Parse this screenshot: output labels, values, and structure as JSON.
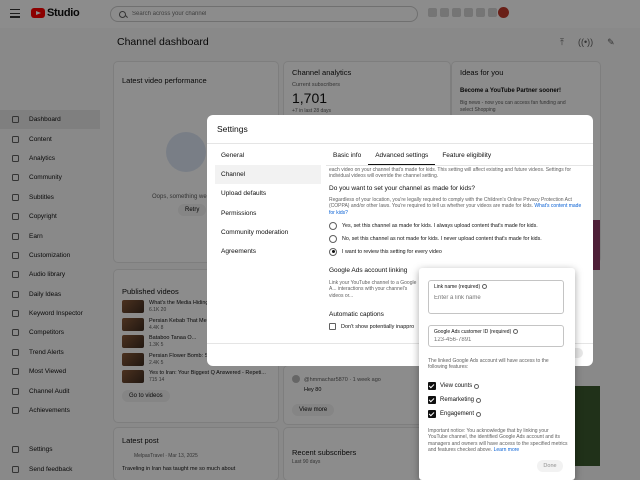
{
  "app": {
    "logo_text": "Studio"
  },
  "search": {
    "placeholder": "Search across your channel"
  },
  "page": {
    "title": "Channel dashboard"
  },
  "sidebar": {
    "items": [
      {
        "label": "Dashboard",
        "icon": "dashboard-icon",
        "active": true
      },
      {
        "label": "Content",
        "icon": "content-icon"
      },
      {
        "label": "Analytics",
        "icon": "analytics-icon"
      },
      {
        "label": "Community",
        "icon": "community-icon"
      },
      {
        "label": "Subtitles",
        "icon": "subtitles-icon"
      },
      {
        "label": "Copyright",
        "icon": "copyright-icon"
      },
      {
        "label": "Earn",
        "icon": "earn-icon"
      },
      {
        "label": "Customization",
        "icon": "customization-icon"
      },
      {
        "label": "Audio library",
        "icon": "audio-library-icon"
      },
      {
        "label": "Daily Ideas",
        "icon": "daily-ideas-icon"
      },
      {
        "label": "Keyword Inspector",
        "icon": "keyword-icon"
      },
      {
        "label": "Competitors",
        "icon": "competitors-icon"
      },
      {
        "label": "Trend Alerts",
        "icon": "trend-icon"
      },
      {
        "label": "Most Viewed",
        "icon": "most-viewed-icon"
      },
      {
        "label": "Channel Audit",
        "icon": "audit-icon"
      },
      {
        "label": "Achievements",
        "icon": "achievements-icon"
      }
    ],
    "bottom": [
      {
        "label": "Settings",
        "icon": "gear-icon"
      },
      {
        "label": "Send feedback",
        "icon": "feedback-icon"
      }
    ]
  },
  "cards": {
    "latest_video": {
      "title": "Latest video performance",
      "error": "Oops, something we",
      "retry": "Retry"
    },
    "analytics": {
      "title": "Channel analytics",
      "subs_label": "Current subscribers",
      "subs_value": "1,701",
      "subs_delta": "+7 in last 28 days"
    },
    "ideas": {
      "title": "Ideas for you",
      "headline": "Become a YouTube Partner sooner!",
      "body": "Big news - now you can access fan funding and select Shopping"
    },
    "published": {
      "title": "Published videos",
      "videos": [
        {
          "title": "What's the Media Hiding",
          "stats": "6.1K  20"
        },
        {
          "title": "Persian Kebab That Melt",
          "stats": "4.4K  8"
        },
        {
          "title": "Bataboo Tanaa O...",
          "stats": "1.3K  5"
        },
        {
          "title": "Persian Flower Bomb: Saff",
          "stats": "2.4K  5"
        },
        {
          "title": "Yes to Iran: Your Biggest Q Answered - Repeti...",
          "stats": "715  14"
        }
      ],
      "go_button": "Go to videos"
    },
    "comment": {
      "author": "@hmmachar5870 · 1 week ago",
      "reply": "Hey 80",
      "view_more": "View more"
    },
    "latest_post": {
      "title": "Latest post",
      "author": "MelpasTravel · Mar 13, 2025",
      "body": "Traveling in Iran has taught me so much about"
    },
    "recent_subs": {
      "title": "Recent subscribers",
      "range": "Last 90 days"
    }
  },
  "settings": {
    "title": "Settings",
    "nav": [
      "General",
      "Channel",
      "Upload defaults",
      "Permissions",
      "Community moderation",
      "Agreements"
    ],
    "active_nav": "Channel",
    "tabs": [
      "Basic info",
      "Advanced settings",
      "Feature eligibility"
    ],
    "active_tab": "Advanced settings",
    "intro": "each video on your channel that's made for kids. This setting will affect existing and future videos. Settings for individual videos will override the channel setting.",
    "question": "Do you want to set your channel as made for kids?",
    "legal": "Regardless of your location, you're legally required to comply with the Children's Online Privacy Protection Act (COPPA) and/or other laws. You're required to tell us whether your videos are made for kids.",
    "legal_link": "What's content made for kids?",
    "options": [
      {
        "label": "Yes, set this channel as made for kids. I always upload content that's made for kids.",
        "selected": false
      },
      {
        "label": "No, set this channel as not made for kids. I never upload content that's made for kids.",
        "selected": false
      },
      {
        "label": "I want to review this setting for every video",
        "selected": true
      }
    ],
    "ads_section": {
      "title": "Google Ads account linking",
      "desc": "Link your YouTube channel to a Google A... interactions with your channel's videos or..."
    },
    "captions": {
      "title": "Automatic captions",
      "checkbox": "Don't show potentially inappro"
    }
  },
  "ads_popover": {
    "link_name_label": "Link name (required)",
    "link_name_placeholder": "Enter a link name",
    "customer_id_label": "Google Ads customer ID (required)",
    "customer_id_placeholder": "123-456-7891",
    "access_text": "The linked Google Ads account will have access to the following features:",
    "features": [
      "View counts",
      "Remarketing",
      "Engagement"
    ],
    "notice": "Important notice: You acknowledge that by linking your YouTube channel, the identified Google Ads account and its managers and owners will have access to the specified metrics and features checked above.",
    "learn_more": "Learn more",
    "done": "Done"
  },
  "colors": {
    "brand": "#ff0000",
    "link": "#065fd4",
    "text": "#0f0f0f",
    "muted": "#606060"
  }
}
